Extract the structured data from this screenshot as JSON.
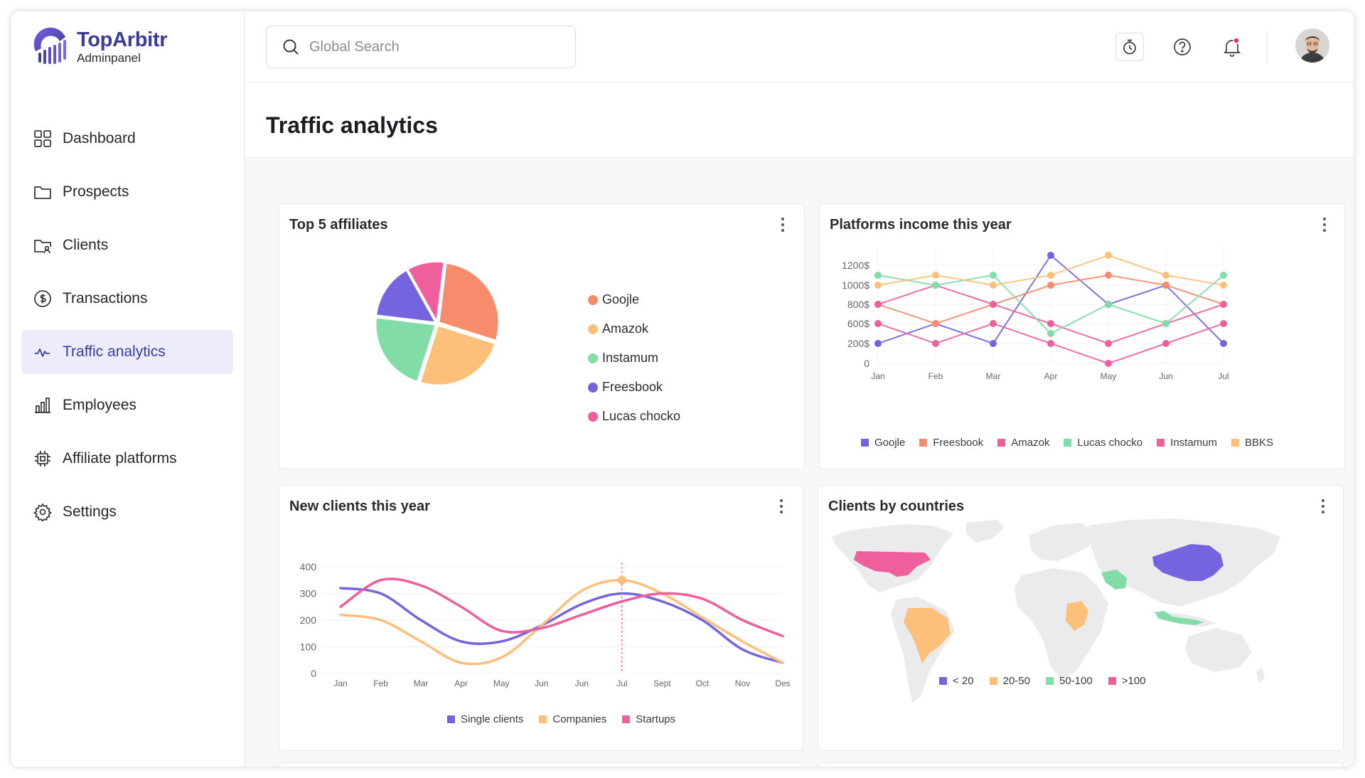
{
  "app": {
    "name": "TopArbitr",
    "subtitle": "Adminpanel"
  },
  "sidebar": {
    "items": [
      {
        "label": "Dashboard",
        "icon": "grid-icon",
        "active": false
      },
      {
        "label": "Prospects",
        "icon": "folder-icon",
        "active": false
      },
      {
        "label": "Clients",
        "icon": "folder-user-icon",
        "active": false
      },
      {
        "label": "Transactions",
        "icon": "dollar-circle-icon",
        "active": false
      },
      {
        "label": "Traffic analytics",
        "icon": "activity-icon",
        "active": true
      },
      {
        "label": "Employees",
        "icon": "bar-chart-icon",
        "active": false
      },
      {
        "label": "Affiliate platforms",
        "icon": "chip-icon",
        "active": false
      },
      {
        "label": "Settings",
        "icon": "gear-icon",
        "active": false
      }
    ]
  },
  "header": {
    "search_placeholder": "Global Search",
    "icons": [
      "timer-icon",
      "help-icon",
      "bell-icon",
      "avatar"
    ]
  },
  "page": {
    "title": "Traffic analytics"
  },
  "colors": {
    "accent": "#3a3c9a",
    "active_bg": "#ececfb",
    "purple": "#7464e0",
    "orange": "#f68c6c",
    "peach": "#fcc07a",
    "green": "#82dca8",
    "pink": "#ef5f9c"
  },
  "cards": {
    "affiliates": {
      "title": "Top 5 affiliates",
      "chart_data": {
        "type": "pie",
        "slices": [
          {
            "label": "Goojle",
            "value": 28,
            "color": "#f68c6c"
          },
          {
            "label": "Amazok",
            "value": 25,
            "color": "#fcc07a"
          },
          {
            "label": "Instamum",
            "value": 22,
            "color": "#82dca8"
          },
          {
            "label": "Freesbook",
            "value": 15,
            "color": "#7464e0"
          },
          {
            "label": "Lucas chocko",
            "value": 10,
            "color": "#ef5f9c"
          }
        ]
      }
    },
    "income": {
      "title": "Platforms income this year",
      "chart_data": {
        "type": "line",
        "categories": [
          "Jan",
          "Feb",
          "Mar",
          "Apr",
          "May",
          "Jun",
          "Jul"
        ],
        "y_ticks": [
          "1200$",
          "1000$",
          "800$",
          "600$",
          "200$",
          "0"
        ],
        "series": [
          {
            "name": "Goojle",
            "color": "#7464e0",
            "values": [
              200,
              600,
              200,
              1300,
              800,
              1000,
              200
            ]
          },
          {
            "name": "Freesbook",
            "color": "#f68c6c",
            "values": [
              800,
              600,
              800,
              1000,
              1100,
              1000,
              800
            ]
          },
          {
            "name": "Amazok",
            "color": "#ef5f9c",
            "values": [
              800,
              1000,
              800,
              600,
              200,
              600,
              800
            ]
          },
          {
            "name": "Lucas chocko",
            "color": "#82dca8",
            "values": [
              1100,
              1000,
              1100,
              400,
              800,
              600,
              1100
            ]
          },
          {
            "name": "Instamum",
            "color": "#ef5f9c",
            "values": [
              600,
              200,
              600,
              200,
              0,
              200,
              600
            ]
          },
          {
            "name": "BBKS",
            "color": "#fcc07a",
            "values": [
              1000,
              1100,
              1000,
              1100,
              1300,
              1100,
              1000
            ]
          }
        ]
      }
    },
    "newclients": {
      "title": "New clients this year",
      "chart_data": {
        "type": "line",
        "categories": [
          "Jan",
          "Feb",
          "Mar",
          "Apr",
          "May",
          "Jun",
          "Jun",
          "Jul",
          "Sept",
          "Oct",
          "Nov",
          "Des"
        ],
        "y_ticks": [
          "400",
          "300",
          "200",
          "100",
          "0"
        ],
        "ylim": [
          0,
          400
        ],
        "series": [
          {
            "name": "Single clients",
            "color": "#7464e0",
            "values": [
              320,
              300,
              200,
              120,
              120,
              180,
              260,
              300,
              270,
              200,
              90,
              40
            ]
          },
          {
            "name": "Companies",
            "color": "#fcc07a",
            "values": [
              220,
              200,
              120,
              40,
              60,
              180,
              310,
              350,
              300,
              210,
              120,
              40
            ]
          },
          {
            "name": "Startups",
            "color": "#ef5f9c",
            "values": [
              250,
              350,
              330,
              250,
              160,
              170,
              220,
              270,
              300,
              280,
              200,
              140
            ]
          }
        ]
      }
    },
    "countries": {
      "title": "Clients by countries",
      "legend": [
        {
          "label": "< 20",
          "color": "#7464e0"
        },
        {
          "label": "20-50",
          "color": "#fcc07a"
        },
        {
          "label": "50-100",
          "color": "#82dca8"
        },
        {
          "label": ">100",
          "color": "#ef5f9c"
        }
      ]
    }
  }
}
